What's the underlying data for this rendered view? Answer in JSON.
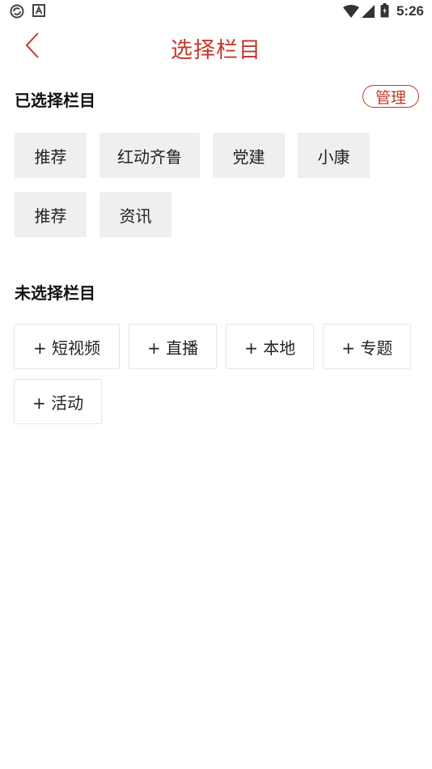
{
  "status_bar": {
    "time": "5:26",
    "icons": [
      "sync-icon",
      "a-badge-icon",
      "wifi-icon",
      "cellular-icon",
      "battery-icon"
    ]
  },
  "header": {
    "title": "选择栏目",
    "back_icon": "chevron-left-icon"
  },
  "selected": {
    "title": "已选择栏目",
    "manage_label": "管理",
    "items": [
      "推荐",
      "红动齐鲁",
      "党建",
      "小康",
      "推荐",
      "资讯"
    ]
  },
  "unselected": {
    "title": "未选择栏目",
    "items": [
      "+ 短视频",
      "+ 直播",
      "+ 本地",
      "+ 专题",
      "+ 活动"
    ]
  },
  "colors": {
    "accent": "#c0392b",
    "chip_bg": "#efefef",
    "chip_border": "#e6e6e6"
  }
}
